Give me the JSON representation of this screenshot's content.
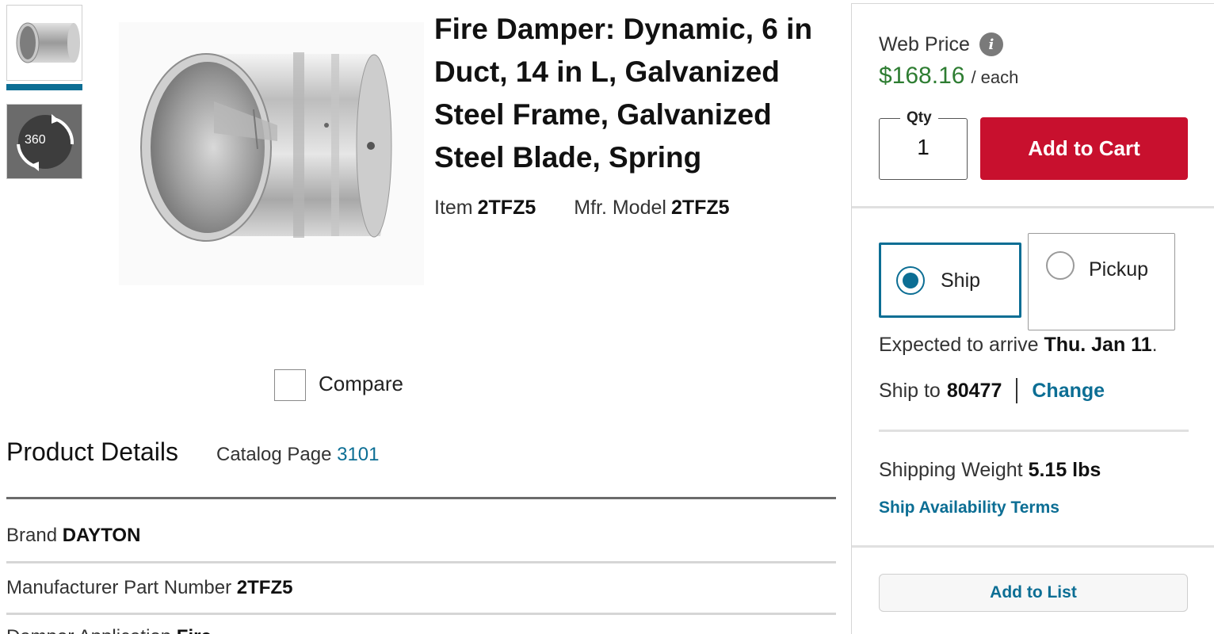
{
  "product": {
    "title": "Fire Damper: Dynamic, 6 in Duct, 14 in L, Galvanized Steel Frame, Galvanized Steel Blade, Spring",
    "item_label": "Item",
    "item_number": "2TFZ5",
    "mfr_model_label": "Mfr. Model",
    "mfr_model": "2TFZ5"
  },
  "gallery": {
    "thumb_360_label": "360",
    "compare_label": "Compare"
  },
  "details": {
    "heading": "Product Details",
    "catalog_label": "Catalog Page",
    "catalog_page": "3101",
    "rows": [
      {
        "label": "Brand",
        "value": "DAYTON"
      },
      {
        "label": "Manufacturer Part Number",
        "value": "2TFZ5"
      },
      {
        "label": "Damper Application",
        "value": "Fire"
      }
    ]
  },
  "purchase": {
    "web_price_label": "Web Price",
    "price": "$168.16",
    "unit": "/ each",
    "qty_label": "Qty",
    "qty_value": "1",
    "add_to_cart": "Add to Cart"
  },
  "fulfillment": {
    "ship_label": "Ship",
    "pickup_label": "Pickup",
    "selected": "ship",
    "arrive_prefix": "Expected to arrive",
    "arrive_date": "Thu. Jan 11",
    "arrive_suffix": ".",
    "ship_to_label": "Ship to",
    "zip": "80477",
    "change_label": "Change",
    "weight_label": "Shipping Weight",
    "weight_value": "5.15 lbs",
    "terms_label": "Ship Availability Terms",
    "add_to_list": "Add to List"
  },
  "colors": {
    "accent": "#0c6e94",
    "cart_red": "#c8102e",
    "price_green": "#2e7d32"
  }
}
